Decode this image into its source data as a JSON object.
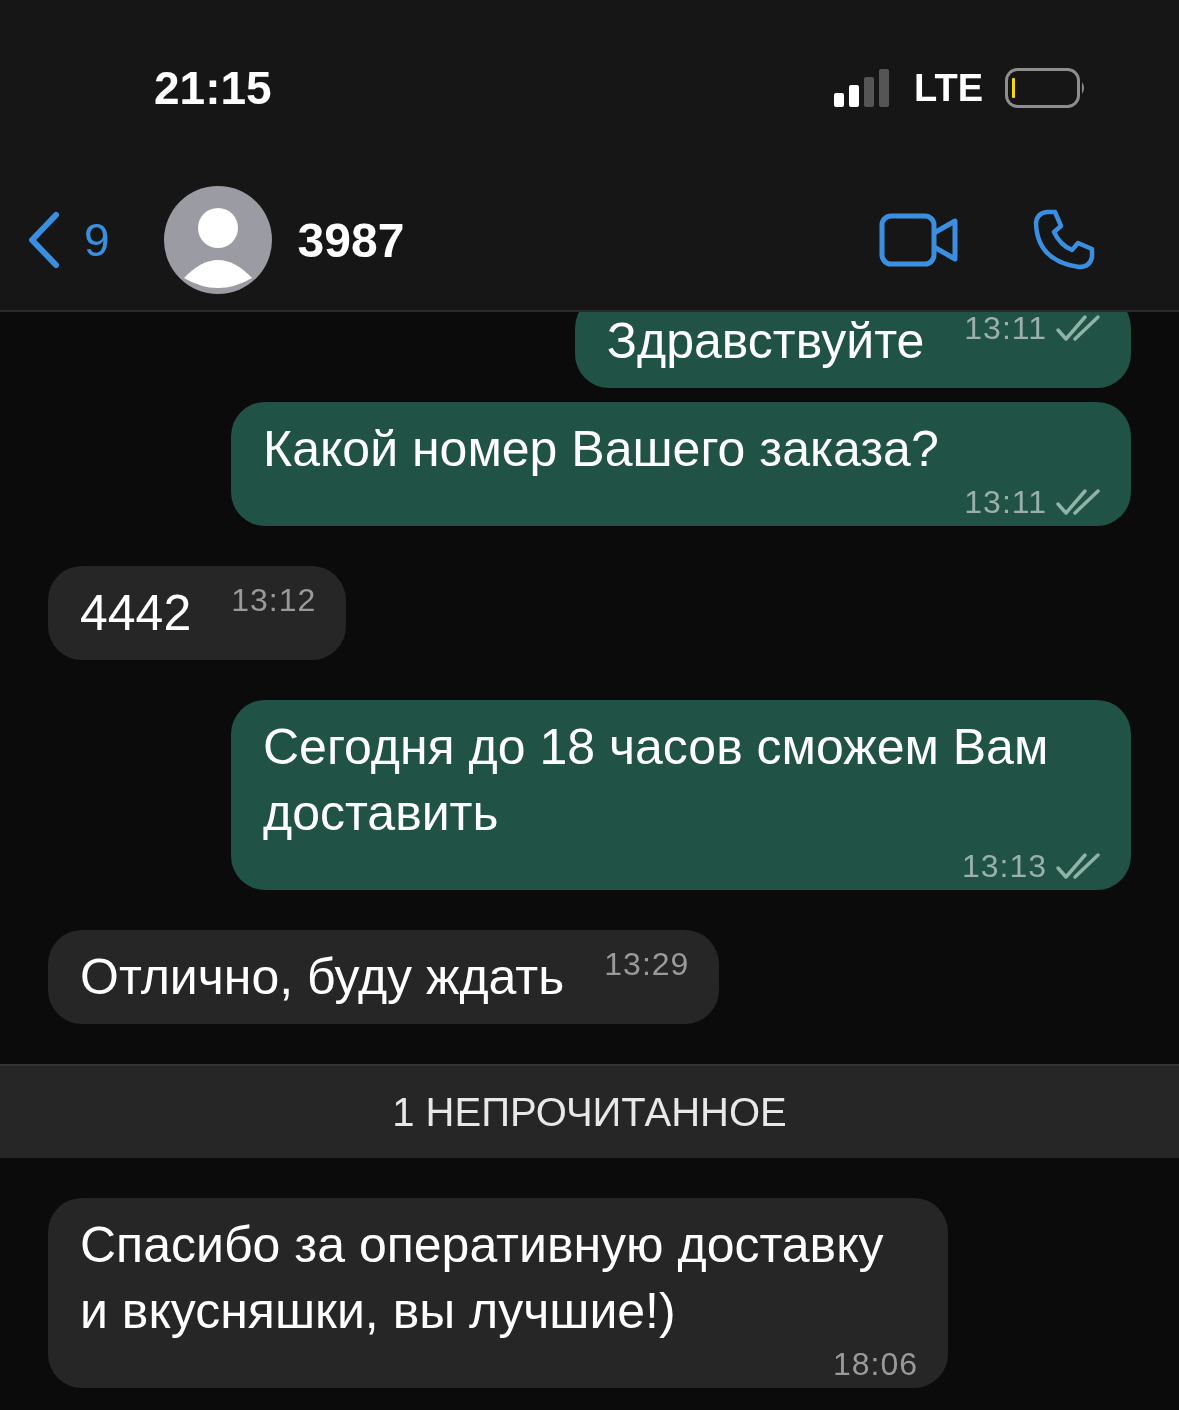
{
  "status_bar": {
    "time": "21:15",
    "network": "LTE"
  },
  "header": {
    "back_count": "9",
    "contact_name": "3987"
  },
  "messages": [
    {
      "kind": "out",
      "text": "Здравствуйте",
      "time": "13:11",
      "read": false
    },
    {
      "kind": "out",
      "text": "Какой номер Вашего заказа?",
      "time": "13:11",
      "read": false
    },
    {
      "kind": "in",
      "text": "4442",
      "time": "13:12"
    },
    {
      "kind": "out",
      "text": "Сегодня до 18 часов сможем Вам доставить",
      "time": "13:13",
      "read": false
    },
    {
      "kind": "in",
      "text": "Отлично, буду ждать",
      "time": "13:29"
    },
    {
      "kind": "divider",
      "text": "1 НЕПРОЧИТАННОЕ"
    },
    {
      "kind": "in",
      "text": "Спасибо за оперативную доставку и вкусняшки, вы лучшие!)",
      "time": "18:06"
    }
  ]
}
